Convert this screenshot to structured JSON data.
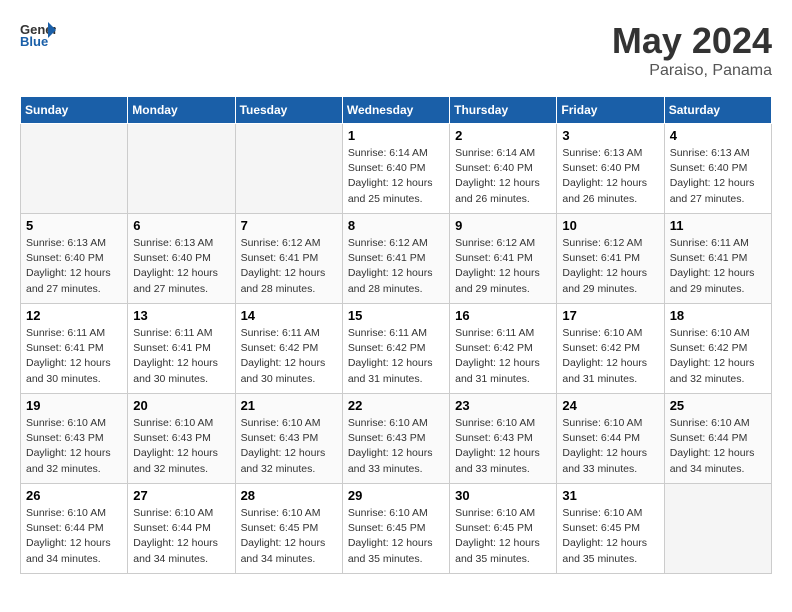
{
  "header": {
    "logo_text_general": "General",
    "logo_text_blue": "Blue",
    "month_title": "May 2024",
    "location": "Paraiso, Panama"
  },
  "days_of_week": [
    "Sunday",
    "Monday",
    "Tuesday",
    "Wednesday",
    "Thursday",
    "Friday",
    "Saturday"
  ],
  "weeks": [
    [
      {
        "day": "",
        "empty": true
      },
      {
        "day": "",
        "empty": true
      },
      {
        "day": "",
        "empty": true
      },
      {
        "day": "1",
        "sunrise": "6:14 AM",
        "sunset": "6:40 PM",
        "daylight": "12 hours and 25 minutes."
      },
      {
        "day": "2",
        "sunrise": "6:14 AM",
        "sunset": "6:40 PM",
        "daylight": "12 hours and 26 minutes."
      },
      {
        "day": "3",
        "sunrise": "6:13 AM",
        "sunset": "6:40 PM",
        "daylight": "12 hours and 26 minutes."
      },
      {
        "day": "4",
        "sunrise": "6:13 AM",
        "sunset": "6:40 PM",
        "daylight": "12 hours and 27 minutes."
      }
    ],
    [
      {
        "day": "5",
        "sunrise": "6:13 AM",
        "sunset": "6:40 PM",
        "daylight": "12 hours and 27 minutes."
      },
      {
        "day": "6",
        "sunrise": "6:13 AM",
        "sunset": "6:40 PM",
        "daylight": "12 hours and 27 minutes."
      },
      {
        "day": "7",
        "sunrise": "6:12 AM",
        "sunset": "6:41 PM",
        "daylight": "12 hours and 28 minutes."
      },
      {
        "day": "8",
        "sunrise": "6:12 AM",
        "sunset": "6:41 PM",
        "daylight": "12 hours and 28 minutes."
      },
      {
        "day": "9",
        "sunrise": "6:12 AM",
        "sunset": "6:41 PM",
        "daylight": "12 hours and 29 minutes."
      },
      {
        "day": "10",
        "sunrise": "6:12 AM",
        "sunset": "6:41 PM",
        "daylight": "12 hours and 29 minutes."
      },
      {
        "day": "11",
        "sunrise": "6:11 AM",
        "sunset": "6:41 PM",
        "daylight": "12 hours and 29 minutes."
      }
    ],
    [
      {
        "day": "12",
        "sunrise": "6:11 AM",
        "sunset": "6:41 PM",
        "daylight": "12 hours and 30 minutes."
      },
      {
        "day": "13",
        "sunrise": "6:11 AM",
        "sunset": "6:41 PM",
        "daylight": "12 hours and 30 minutes."
      },
      {
        "day": "14",
        "sunrise": "6:11 AM",
        "sunset": "6:42 PM",
        "daylight": "12 hours and 30 minutes."
      },
      {
        "day": "15",
        "sunrise": "6:11 AM",
        "sunset": "6:42 PM",
        "daylight": "12 hours and 31 minutes."
      },
      {
        "day": "16",
        "sunrise": "6:11 AM",
        "sunset": "6:42 PM",
        "daylight": "12 hours and 31 minutes."
      },
      {
        "day": "17",
        "sunrise": "6:10 AM",
        "sunset": "6:42 PM",
        "daylight": "12 hours and 31 minutes."
      },
      {
        "day": "18",
        "sunrise": "6:10 AM",
        "sunset": "6:42 PM",
        "daylight": "12 hours and 32 minutes."
      }
    ],
    [
      {
        "day": "19",
        "sunrise": "6:10 AM",
        "sunset": "6:43 PM",
        "daylight": "12 hours and 32 minutes."
      },
      {
        "day": "20",
        "sunrise": "6:10 AM",
        "sunset": "6:43 PM",
        "daylight": "12 hours and 32 minutes."
      },
      {
        "day": "21",
        "sunrise": "6:10 AM",
        "sunset": "6:43 PM",
        "daylight": "12 hours and 32 minutes."
      },
      {
        "day": "22",
        "sunrise": "6:10 AM",
        "sunset": "6:43 PM",
        "daylight": "12 hours and 33 minutes."
      },
      {
        "day": "23",
        "sunrise": "6:10 AM",
        "sunset": "6:43 PM",
        "daylight": "12 hours and 33 minutes."
      },
      {
        "day": "24",
        "sunrise": "6:10 AM",
        "sunset": "6:44 PM",
        "daylight": "12 hours and 33 minutes."
      },
      {
        "day": "25",
        "sunrise": "6:10 AM",
        "sunset": "6:44 PM",
        "daylight": "12 hours and 34 minutes."
      }
    ],
    [
      {
        "day": "26",
        "sunrise": "6:10 AM",
        "sunset": "6:44 PM",
        "daylight": "12 hours and 34 minutes."
      },
      {
        "day": "27",
        "sunrise": "6:10 AM",
        "sunset": "6:44 PM",
        "daylight": "12 hours and 34 minutes."
      },
      {
        "day": "28",
        "sunrise": "6:10 AM",
        "sunset": "6:45 PM",
        "daylight": "12 hours and 34 minutes."
      },
      {
        "day": "29",
        "sunrise": "6:10 AM",
        "sunset": "6:45 PM",
        "daylight": "12 hours and 35 minutes."
      },
      {
        "day": "30",
        "sunrise": "6:10 AM",
        "sunset": "6:45 PM",
        "daylight": "12 hours and 35 minutes."
      },
      {
        "day": "31",
        "sunrise": "6:10 AM",
        "sunset": "6:45 PM",
        "daylight": "12 hours and 35 minutes."
      },
      {
        "day": "",
        "empty": true
      }
    ]
  ]
}
